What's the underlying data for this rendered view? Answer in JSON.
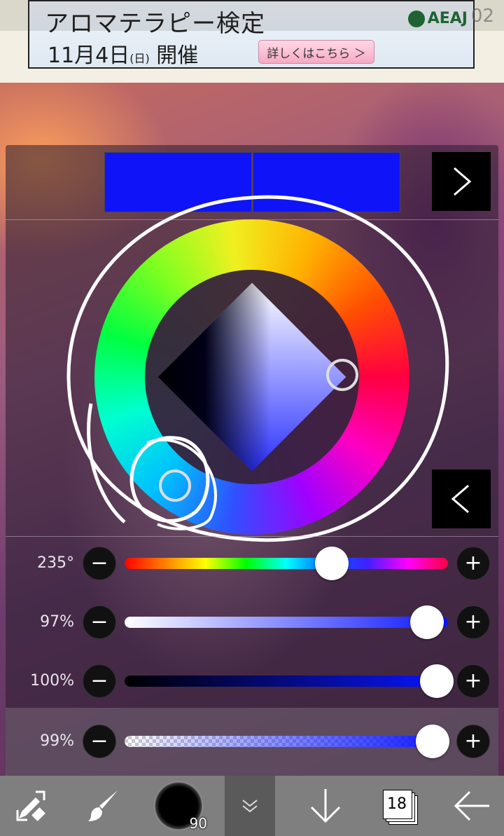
{
  "ad": {
    "title": "アロマテラピー検定",
    "date_prefix": "11月4日",
    "date_day": "(日)",
    "date_suffix": " 開催",
    "button_label": "詳しくはこちら ＞",
    "logo": "AEAJ"
  },
  "status": {
    "time": "02"
  },
  "color_panel": {
    "primary_color": "#0f14f8",
    "secondary_color": "#0f14f8",
    "next_button_icon": "chevron-right-icon",
    "prev_button_icon": "chevron-left-icon"
  },
  "sliders": {
    "hue": {
      "label": "235°",
      "value": 235,
      "fraction": 0.64
    },
    "saturation": {
      "label": "97%",
      "value": 97,
      "fraction": 0.97
    },
    "brightness": {
      "label": "100%",
      "value": 100,
      "fraction": 1.0
    },
    "opacity": {
      "label": "99%",
      "value": 99,
      "fraction": 0.99
    },
    "minus_label": "−",
    "plus_label": "+"
  },
  "toolbar": {
    "brush_size": "90",
    "layer_count": "18",
    "icons": [
      "swap-tool-icon",
      "brush-icon",
      "brush-preview",
      "chevron-down-icon",
      "arrow-down-icon",
      "layers-icon",
      "arrow-left-icon"
    ]
  }
}
